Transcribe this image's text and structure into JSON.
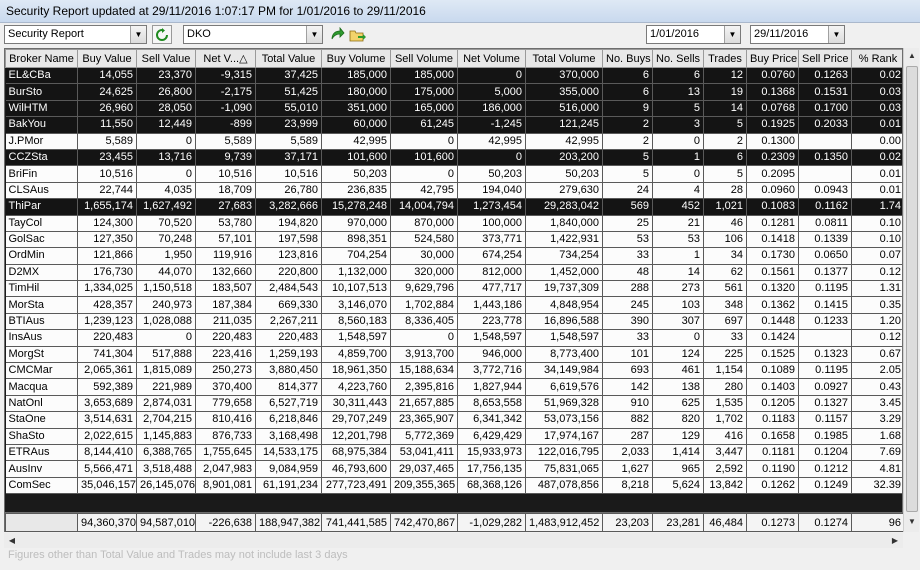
{
  "window": {
    "title": "Security Report updated at 29/11/2016 1:07:17 PM for 1/01/2016 to 29/11/2016"
  },
  "toolbar": {
    "report_type": "Security Report",
    "security_code": "DKO",
    "date_from": "1/01/2016",
    "date_to": "29/11/2016",
    "refresh_icon": "refresh-icon",
    "run_icon": "green-arrow-icon",
    "export_icon": "folder-export-icon"
  },
  "colors": {
    "row_light": "#fcfcfc",
    "row_dark": "#141414",
    "header_bg": "#e8e8e8"
  },
  "columns": [
    "Broker Name",
    "Buy Value",
    "Sell Value",
    "Net V...",
    "Total Value",
    "Buy Volume",
    "Sell Volume",
    "Net Volume",
    "Total Volume",
    "No. Buys",
    "No. Sells",
    "Trades",
    "Buy Price",
    "Sell Price",
    "% Rank"
  ],
  "sort_indicator": "△",
  "rows": [
    {
      "shade": "dark",
      "cells": [
        "EL&CBa",
        "14,055",
        "23,370",
        "-9,315",
        "37,425",
        "185,000",
        "185,000",
        "0",
        "370,000",
        "6",
        "6",
        "12",
        "0.0760",
        "0.1263",
        "0.02"
      ]
    },
    {
      "shade": "dark",
      "cells": [
        "BurSto",
        "24,625",
        "26,800",
        "-2,175",
        "51,425",
        "180,000",
        "175,000",
        "5,000",
        "355,000",
        "6",
        "13",
        "19",
        "0.1368",
        "0.1531",
        "0.03"
      ]
    },
    {
      "shade": "dark",
      "cells": [
        "WilHTM",
        "26,960",
        "28,050",
        "-1,090",
        "55,010",
        "351,000",
        "165,000",
        "186,000",
        "516,000",
        "9",
        "5",
        "14",
        "0.0768",
        "0.1700",
        "0.03"
      ]
    },
    {
      "shade": "dark",
      "cells": [
        "BakYou",
        "11,550",
        "12,449",
        "-899",
        "23,999",
        "60,000",
        "61,245",
        "-1,245",
        "121,245",
        "2",
        "3",
        "5",
        "0.1925",
        "0.2033",
        "0.01"
      ]
    },
    {
      "shade": "light",
      "cells": [
        "J.PMor",
        "5,589",
        "0",
        "5,589",
        "5,589",
        "42,995",
        "0",
        "42,995",
        "42,995",
        "2",
        "0",
        "2",
        "0.1300",
        "",
        "0.00"
      ]
    },
    {
      "shade": "dark",
      "cells": [
        "CCZSta",
        "23,455",
        "13,716",
        "9,739",
        "37,171",
        "101,600",
        "101,600",
        "0",
        "203,200",
        "5",
        "1",
        "6",
        "0.2309",
        "0.1350",
        "0.02"
      ]
    },
    {
      "shade": "light",
      "cells": [
        "BriFin",
        "10,516",
        "0",
        "10,516",
        "10,516",
        "50,203",
        "0",
        "50,203",
        "50,203",
        "5",
        "0",
        "5",
        "0.2095",
        "",
        "0.01"
      ]
    },
    {
      "shade": "light",
      "cells": [
        "CLSAus",
        "22,744",
        "4,035",
        "18,709",
        "26,780",
        "236,835",
        "42,795",
        "194,040",
        "279,630",
        "24",
        "4",
        "28",
        "0.0960",
        "0.0943",
        "0.01"
      ]
    },
    {
      "shade": "dark",
      "cells": [
        "ThiPar",
        "1,655,174",
        "1,627,492",
        "27,683",
        "3,282,666",
        "15,278,248",
        "14,004,794",
        "1,273,454",
        "29,283,042",
        "569",
        "452",
        "1,021",
        "0.1083",
        "0.1162",
        "1.74"
      ]
    },
    {
      "shade": "light",
      "cells": [
        "TayCol",
        "124,300",
        "70,520",
        "53,780",
        "194,820",
        "970,000",
        "870,000",
        "100,000",
        "1,840,000",
        "25",
        "21",
        "46",
        "0.1281",
        "0.0811",
        "0.10"
      ]
    },
    {
      "shade": "light",
      "cells": [
        "GolSac",
        "127,350",
        "70,248",
        "57,101",
        "197,598",
        "898,351",
        "524,580",
        "373,771",
        "1,422,931",
        "53",
        "53",
        "106",
        "0.1418",
        "0.1339",
        "0.10"
      ]
    },
    {
      "shade": "light",
      "cells": [
        "OrdMin",
        "121,866",
        "1,950",
        "119,916",
        "123,816",
        "704,254",
        "30,000",
        "674,254",
        "734,254",
        "33",
        "1",
        "34",
        "0.1730",
        "0.0650",
        "0.07"
      ]
    },
    {
      "shade": "light",
      "cells": [
        "D2MX",
        "176,730",
        "44,070",
        "132,660",
        "220,800",
        "1,132,000",
        "320,000",
        "812,000",
        "1,452,000",
        "48",
        "14",
        "62",
        "0.1561",
        "0.1377",
        "0.12"
      ]
    },
    {
      "shade": "light",
      "cells": [
        "TimHil",
        "1,334,025",
        "1,150,518",
        "183,507",
        "2,484,543",
        "10,107,513",
        "9,629,796",
        "477,717",
        "19,737,309",
        "288",
        "273",
        "561",
        "0.1320",
        "0.1195",
        "1.31"
      ]
    },
    {
      "shade": "light",
      "cells": [
        "MorSta",
        "428,357",
        "240,973",
        "187,384",
        "669,330",
        "3,146,070",
        "1,702,884",
        "1,443,186",
        "4,848,954",
        "245",
        "103",
        "348",
        "0.1362",
        "0.1415",
        "0.35"
      ]
    },
    {
      "shade": "light",
      "cells": [
        "BTIAus",
        "1,239,123",
        "1,028,088",
        "211,035",
        "2,267,211",
        "8,560,183",
        "8,336,405",
        "223,778",
        "16,896,588",
        "390",
        "307",
        "697",
        "0.1448",
        "0.1233",
        "1.20"
      ]
    },
    {
      "shade": "light",
      "cells": [
        "InsAus",
        "220,483",
        "0",
        "220,483",
        "220,483",
        "1,548,597",
        "0",
        "1,548,597",
        "1,548,597",
        "33",
        "0",
        "33",
        "0.1424",
        "",
        "0.12"
      ]
    },
    {
      "shade": "light",
      "cells": [
        "MorgSt",
        "741,304",
        "517,888",
        "223,416",
        "1,259,193",
        "4,859,700",
        "3,913,700",
        "946,000",
        "8,773,400",
        "101",
        "124",
        "225",
        "0.1525",
        "0.1323",
        "0.67"
      ]
    },
    {
      "shade": "light",
      "cells": [
        "CMCMar",
        "2,065,361",
        "1,815,089",
        "250,273",
        "3,880,450",
        "18,961,350",
        "15,188,634",
        "3,772,716",
        "34,149,984",
        "693",
        "461",
        "1,154",
        "0.1089",
        "0.1195",
        "2.05"
      ]
    },
    {
      "shade": "light",
      "cells": [
        "Macqua",
        "592,389",
        "221,989",
        "370,400",
        "814,377",
        "4,223,760",
        "2,395,816",
        "1,827,944",
        "6,619,576",
        "142",
        "138",
        "280",
        "0.1403",
        "0.0927",
        "0.43"
      ]
    },
    {
      "shade": "light",
      "cells": [
        "NatOnl",
        "3,653,689",
        "2,874,031",
        "779,658",
        "6,527,719",
        "30,311,443",
        "21,657,885",
        "8,653,558",
        "51,969,328",
        "910",
        "625",
        "1,535",
        "0.1205",
        "0.1327",
        "3.45"
      ]
    },
    {
      "shade": "light",
      "cells": [
        "StaOne",
        "3,514,631",
        "2,704,215",
        "810,416",
        "6,218,846",
        "29,707,249",
        "23,365,907",
        "6,341,342",
        "53,073,156",
        "882",
        "820",
        "1,702",
        "0.1183",
        "0.1157",
        "3.29"
      ]
    },
    {
      "shade": "light",
      "cells": [
        "ShaSto",
        "2,022,615",
        "1,145,883",
        "876,733",
        "3,168,498",
        "12,201,798",
        "5,772,369",
        "6,429,429",
        "17,974,167",
        "287",
        "129",
        "416",
        "0.1658",
        "0.1985",
        "1.68"
      ]
    },
    {
      "shade": "light",
      "cells": [
        "ETRAus",
        "8,144,410",
        "6,388,765",
        "1,755,645",
        "14,533,175",
        "68,975,384",
        "53,041,411",
        "15,933,973",
        "122,016,795",
        "2,033",
        "1,414",
        "3,447",
        "0.1181",
        "0.1204",
        "7.69"
      ]
    },
    {
      "shade": "light",
      "cells": [
        "AusInv",
        "5,566,471",
        "3,518,488",
        "2,047,983",
        "9,084,959",
        "46,793,600",
        "29,037,465",
        "17,756,135",
        "75,831,065",
        "1,627",
        "965",
        "2,592",
        "0.1190",
        "0.1212",
        "4.81"
      ]
    },
    {
      "shade": "light",
      "cells": [
        "ComSec",
        "35,046,157",
        "26,145,076",
        "8,901,081",
        "61,191,234",
        "277,723,491",
        "209,355,365",
        "68,368,126",
        "487,078,856",
        "8,218",
        "5,624",
        "13,842",
        "0.1262",
        "0.1249",
        "32.39"
      ]
    }
  ],
  "totals": [
    "",
    "94,360,370",
    "94,587,010",
    "-226,638",
    "188,947,382",
    "741,441,585",
    "742,470,867",
    "-1,029,282",
    "1,483,912,452",
    "23,203",
    "23,281",
    "46,484",
    "0.1273",
    "0.1274",
    "96"
  ],
  "footnote": "Figures other than Total Value and Trades may not include last 3 days"
}
